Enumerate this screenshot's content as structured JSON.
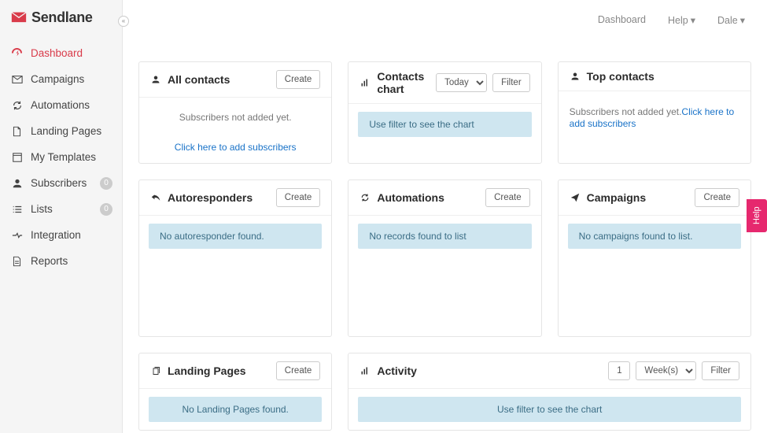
{
  "brand": {
    "name": "Sendlane"
  },
  "topbar": {
    "breadcrumb": "Dashboard",
    "help_label": "Help",
    "user_label": "Dale"
  },
  "sidebar": {
    "items": [
      {
        "label": "Dashboard",
        "badge": null,
        "active": true
      },
      {
        "label": "Campaigns",
        "badge": null,
        "active": false
      },
      {
        "label": "Automations",
        "badge": null,
        "active": false
      },
      {
        "label": "Landing Pages",
        "badge": null,
        "active": false
      },
      {
        "label": "My Templates",
        "badge": null,
        "active": false
      },
      {
        "label": "Subscribers",
        "badge": "0",
        "active": false
      },
      {
        "label": "Lists",
        "badge": "0",
        "active": false
      },
      {
        "label": "Integration",
        "badge": null,
        "active": false
      },
      {
        "label": "Reports",
        "badge": null,
        "active": false
      }
    ]
  },
  "panels": {
    "all_contacts": {
      "title": "All contacts",
      "create_btn": "Create",
      "empty_text": "Subscribers not added yet.",
      "link_text": "Click here to add subscribers"
    },
    "contacts_chart": {
      "title": "Contacts chart",
      "range_value": "Today",
      "filter_btn": "Filter",
      "info": "Use filter to see the chart"
    },
    "top_contacts": {
      "title": "Top contacts",
      "empty_text": "Subscribers not added yet.",
      "link_text": "Click here to add subscribers"
    },
    "autoresponders": {
      "title": "Autoresponders",
      "create_btn": "Create",
      "info": "No autoresponder found."
    },
    "automations": {
      "title": "Automations",
      "create_btn": "Create",
      "info": "No records found to list"
    },
    "campaigns": {
      "title": "Campaigns",
      "create_btn": "Create",
      "info": "No campaigns found to list."
    },
    "landing_pages": {
      "title": "Landing Pages",
      "create_btn": "Create",
      "info": "No Landing Pages found."
    },
    "activity": {
      "title": "Activity",
      "num_value": "1",
      "unit_value": "Week(s)",
      "filter_btn": "Filter",
      "info": "Use filter to see the chart"
    }
  },
  "help_tab": "Help"
}
